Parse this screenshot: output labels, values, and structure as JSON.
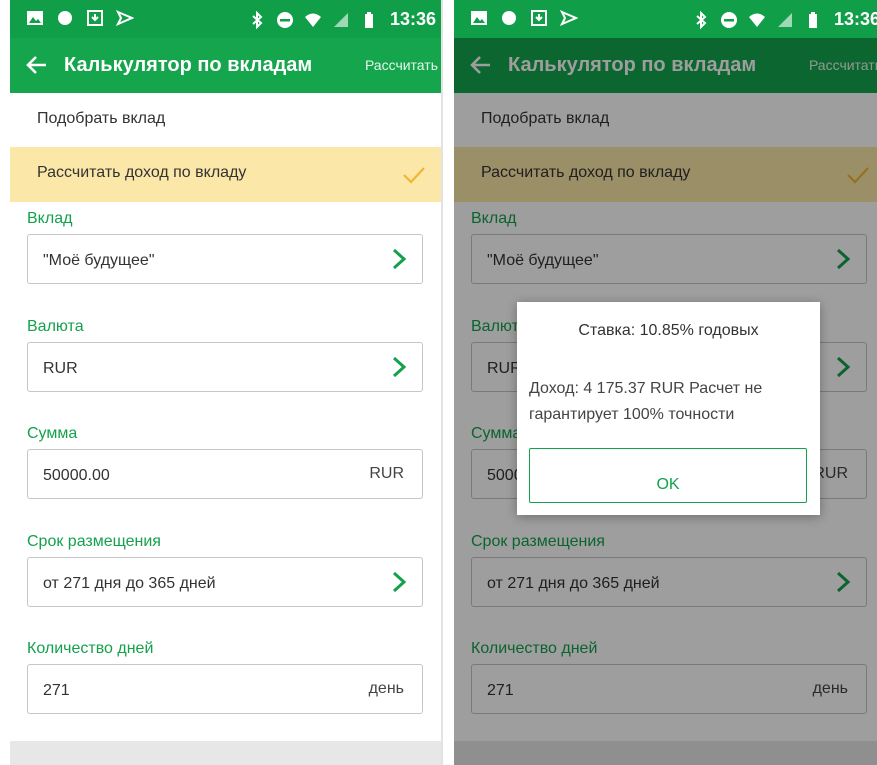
{
  "status_bar": {
    "time": "13:36"
  },
  "app_bar": {
    "title": "Калькулятор по вкладам",
    "action_label": "Рассчитать"
  },
  "modes": {
    "pick_deposit": "Подобрать вклад",
    "calc_income": "Рассчитать доход по вкладу"
  },
  "form": {
    "deposit": {
      "label": "Вклад",
      "value": "\"Моё будущее\""
    },
    "currency": {
      "label": "Валюта",
      "value": "RUR"
    },
    "amount": {
      "label": "Сумма",
      "value": "50000.00",
      "unit": "RUR"
    },
    "term": {
      "label": "Срок размещения",
      "value": "от 271 дня до 365 дней"
    },
    "days": {
      "label": "Количество дней",
      "value": "271",
      "unit": "день"
    }
  },
  "dialog": {
    "title": "Ставка: 10.85% годовых",
    "message": "Доход: 4 175.37 RUR Расчет не гарантирует 100% точности",
    "ok_label": "OK"
  },
  "colors": {
    "primary": "#14a54d",
    "status_bar": "#109f48",
    "selected_row": "#fbe7a8",
    "check": "#f2b732",
    "label_green": "#14a14c"
  },
  "icons": [
    "image-icon",
    "circle-icon",
    "download-icon",
    "send-icon",
    "bluetooth-icon",
    "do-not-disturb-icon",
    "wifi-icon",
    "signal-icon",
    "battery-icon",
    "back-arrow-icon",
    "check-icon",
    "chevron-right-icon"
  ]
}
